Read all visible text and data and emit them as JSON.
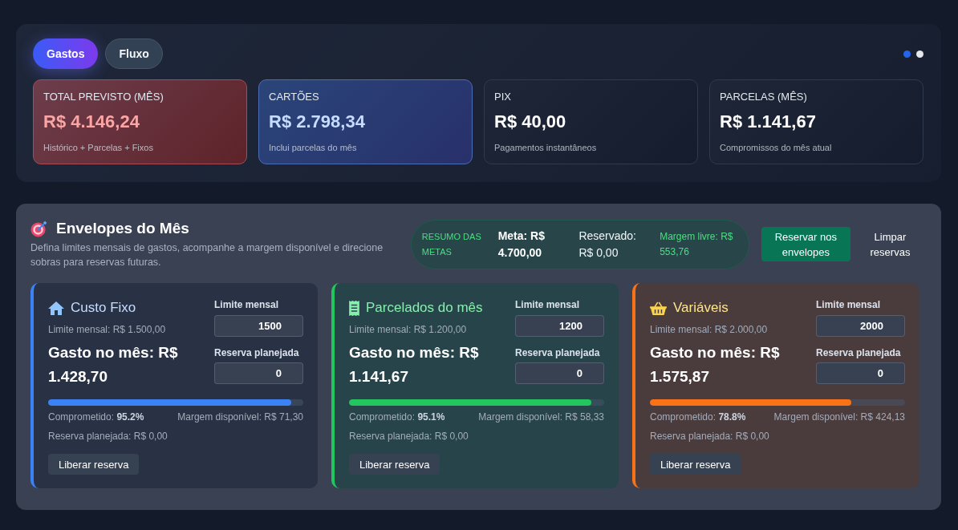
{
  "tabs": [
    {
      "label": "Gastos",
      "selected": true
    },
    {
      "label": "Fluxo",
      "selected": false
    }
  ],
  "pager_dots": [
    {
      "selected": true
    },
    {
      "selected": false
    }
  ],
  "stat_cards": [
    {
      "kind": "danger",
      "label": "TOTAL PREVISTO (MÊS)",
      "value": "R$ 4.146,24",
      "note": "Histórico + Parcelas + Fixos"
    },
    {
      "kind": "info",
      "label": "CARTÕES",
      "value": "R$ 2.798,34",
      "note": "Inclui parcelas do mês"
    },
    {
      "kind": "plain",
      "label": "PIX",
      "value": "R$ 40,00",
      "note": "Pagamentos instantâneos"
    },
    {
      "kind": "plain",
      "label": "PARCELAS (MÊS)",
      "value": "R$ 1.141,67",
      "note": "Compromissos do mês atual"
    }
  ],
  "envelopes_header": {
    "title": "Envelopes do Mês",
    "description": "Defina limites mensais de gastos, acompanhe a margem disponível e direcione sobras para reservas futuras."
  },
  "goals_summary": {
    "label": "RESUMO DAS METAS",
    "goal": "Meta: R$ 4.700,00",
    "reserved": "Reservado: R$ 0,00",
    "free_margin": "Margem livre: R$ 553,76"
  },
  "actions": [
    {
      "kind": "primary",
      "label": "Reservar nos envelopes"
    },
    {
      "kind": "plain",
      "label": "Limpar reservas"
    }
  ],
  "envelopes": [
    {
      "kind": "fixed",
      "color": "#3b82f6",
      "title": "Custo Fixo",
      "limit_text": "Limite mensal: R$ 1.500,00",
      "spent": "Gasto no mês: R$ 1.428,70",
      "limit_label": "Limite mensal",
      "limit_value": "1500",
      "reserve_label": "Reserva planejada",
      "reserve_value": "0",
      "level": 0.952,
      "committed": "Comprometido: **95.2%**",
      "margin": "Margem disponível: R$ 71,30",
      "planned": "Reserva planejada: R$ 0,00",
      "release_button": "Liberar reserva"
    },
    {
      "kind": "installments",
      "color": "#22c55e",
      "title": "Parcelados do mês",
      "limit_text": "Limite mensal: R$ 1.200,00",
      "spent": "Gasto no mês: R$ 1.141,67",
      "limit_label": "Limite mensal",
      "limit_value": "1200",
      "reserve_label": "Reserva planejada",
      "reserve_value": "0",
      "level": 0.951,
      "committed": "Comprometido: **95.1%**",
      "margin": "Margem disponível: R$ 58,33",
      "planned": "Reserva planejada: R$ 0,00",
      "release_button": "Liberar reserva"
    },
    {
      "kind": "variable",
      "color": "#f97316",
      "title": "Variáveis",
      "limit_text": "Limite mensal: R$ 2.000,00",
      "spent": "Gasto no mês: R$ 1.575,87",
      "limit_label": "Limite mensal",
      "limit_value": "2000",
      "reserve_label": "Reserva planejada",
      "reserve_value": "0",
      "level": 0.788,
      "committed": "Comprometido: **78.8%**",
      "margin": "Margem disponível: R$ 424,13",
      "planned": "Reserva planejada: R$ 0,00",
      "release_button": "Liberar reserva"
    }
  ]
}
